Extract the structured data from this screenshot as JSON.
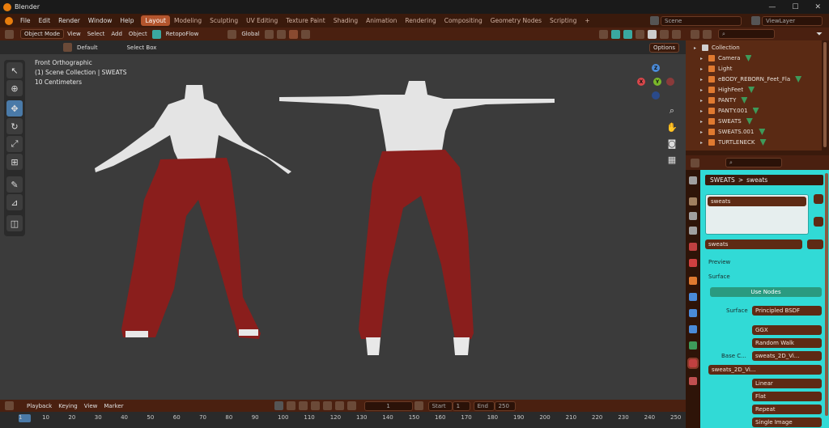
{
  "window": {
    "title": "Blender",
    "controls": [
      "—",
      "☐",
      "✕"
    ]
  },
  "menu": [
    "File",
    "Edit",
    "Render",
    "Window",
    "Help"
  ],
  "workspaces": [
    {
      "label": "Layout",
      "active": true
    },
    {
      "label": "Modeling",
      "active": false
    },
    {
      "label": "Sculpting",
      "active": false
    },
    {
      "label": "UV Editing",
      "active": false
    },
    {
      "label": "Texture Paint",
      "active": false
    },
    {
      "label": "Shading",
      "active": false
    },
    {
      "label": "Animation",
      "active": false
    },
    {
      "label": "Rendering",
      "active": false
    },
    {
      "label": "Compositing",
      "active": false
    },
    {
      "label": "Geometry Nodes",
      "active": false
    },
    {
      "label": "Scripting",
      "active": false
    }
  ],
  "add_workspace": "+",
  "scene": {
    "placeholder": "Scene",
    "viewlayer": "ViewLayer"
  },
  "viewport_header": {
    "mode": "Object Mode",
    "items": [
      "View",
      "Select",
      "Add",
      "Object"
    ],
    "retopo": "RetopoFlow",
    "orientation": "Global",
    "orientation_dd": "Default",
    "drag": "Select Box",
    "options": "Options"
  },
  "viewport": {
    "line1": "Front Orthographic",
    "line2": "(1) Scene Collection | SWEATS",
    "line3": "10 Centimeters",
    "gizmo": {
      "x": "X",
      "y": "Y",
      "z": "Z"
    }
  },
  "timeline": {
    "menus": [
      "Playback",
      "Keying",
      "View",
      "Marker"
    ],
    "current_frame": "1",
    "start_label": "Start",
    "start": "1",
    "end_label": "End",
    "end": "250",
    "ticks": [
      "1",
      "10",
      "20",
      "30",
      "40",
      "50",
      "60",
      "70",
      "80",
      "90",
      "100",
      "110",
      "120",
      "130",
      "140",
      "150",
      "160",
      "170",
      "180",
      "190",
      "200",
      "210",
      "220",
      "230",
      "240",
      "250"
    ]
  },
  "outliner": {
    "items": [
      {
        "label": "Collection",
        "indent": 0,
        "type": "collection"
      },
      {
        "label": "Camera",
        "indent": 1,
        "type": "camera"
      },
      {
        "label": "Light",
        "indent": 1,
        "type": "light"
      },
      {
        "label": "eBODY_REBORN_Feet_Fla",
        "indent": 1,
        "type": "mesh"
      },
      {
        "label": "HighFeet",
        "indent": 1,
        "type": "mesh"
      },
      {
        "label": "PANTY",
        "indent": 1,
        "type": "mesh"
      },
      {
        "label": "PANTY.001",
        "indent": 1,
        "type": "mesh"
      },
      {
        "label": "SWEATS",
        "indent": 1,
        "type": "mesh"
      },
      {
        "label": "SWEATS.001",
        "indent": 1,
        "type": "mesh"
      },
      {
        "label": "TURTLENECK",
        "indent": 1,
        "type": "mesh"
      }
    ]
  },
  "properties": {
    "breadcrumb_object": "SWEATS",
    "breadcrumb_sep": ">",
    "breadcrumb_material": "sweats",
    "slot": "sweats",
    "material_name": "sweats",
    "preview": "Preview",
    "surface_section": "Surface",
    "use_nodes": "Use Nodes",
    "surface_label": "Surface",
    "surface_value": "Principled BSDF",
    "distribution": "GGX",
    "subsurface": "Random Walk",
    "base_color_label": "Base C...",
    "base_color_value": "sweats_2D_Vi...",
    "image_name": "sweats_2D_Vi...",
    "interpolation": "Linear",
    "projection": "Flat",
    "extension": "Repeat",
    "source": "Single Image"
  },
  "colors": {
    "theme_dark": "#3a1a0c",
    "theme_header": "#4a2010",
    "accent": "#b3552d",
    "props_bg": "#31dad6",
    "pants": "#8a1e1c",
    "skin": "#e4e4e4"
  }
}
